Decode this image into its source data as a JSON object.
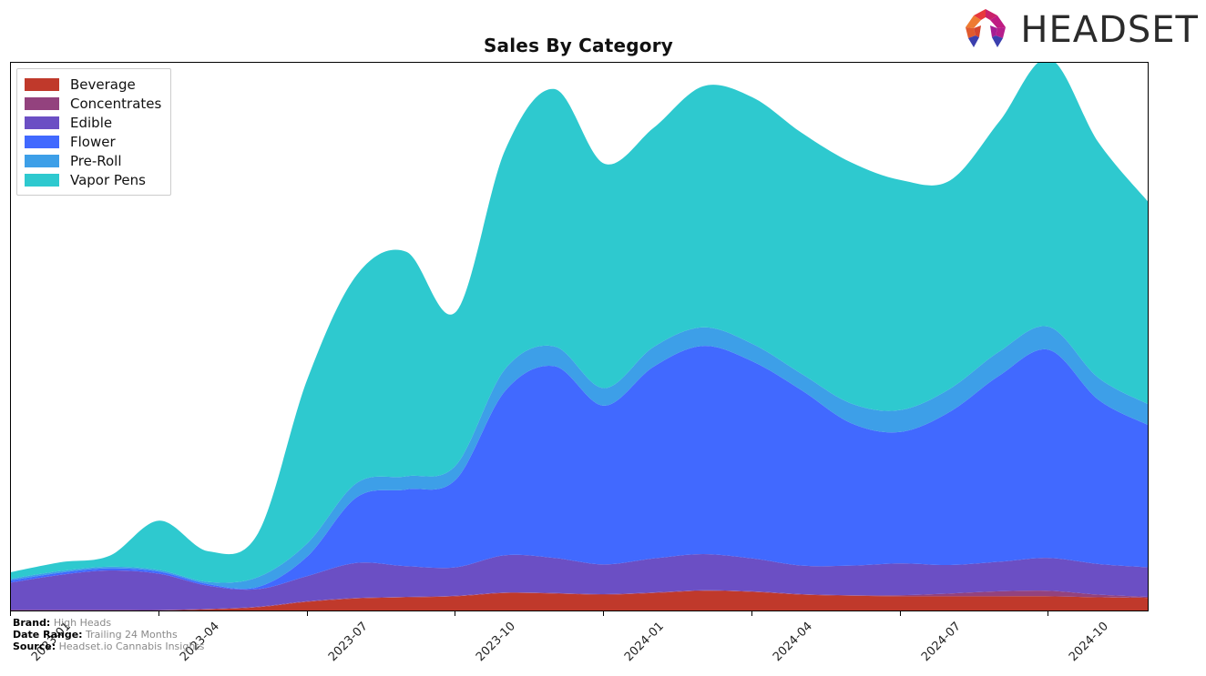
{
  "header": {
    "title": "Sales By Category",
    "logo_word": "HEADSET",
    "logo_icon": "headset-arch-logo"
  },
  "footer": {
    "lines": [
      {
        "key": "Brand:",
        "value": "High Heads"
      },
      {
        "key": "Date Range:",
        "value": "Trailing 24 Months"
      },
      {
        "key": "Source:",
        "value": "Headset.io Cannabis Insights"
      }
    ]
  },
  "legend": {
    "position": "upper-left",
    "items": [
      {
        "label": "Beverage",
        "color": "#c0392b"
      },
      {
        "label": "Concentrates",
        "color": "#93427e"
      },
      {
        "label": "Edible",
        "color": "#6b4fc4"
      },
      {
        "label": "Flower",
        "color": "#4169ff"
      },
      {
        "label": "Pre-Roll",
        "color": "#3d9fe8"
      },
      {
        "label": "Vapor Pens",
        "color": "#2ec9cf"
      }
    ]
  },
  "chart_data": {
    "type": "area",
    "stacked": true,
    "title": "Sales By Category",
    "xlabel": "",
    "ylabel": "",
    "grid": false,
    "legend_position": "upper left",
    "x": [
      "2023-01",
      "2023-02",
      "2023-03",
      "2023-04",
      "2023-05",
      "2023-06",
      "2023-07",
      "2023-08",
      "2023-09",
      "2023-10",
      "2023-11",
      "2023-12",
      "2024-01",
      "2024-02",
      "2024-03",
      "2024-04",
      "2024-05",
      "2024-06",
      "2024-07",
      "2024-08",
      "2024-09",
      "2024-10",
      "2024-11",
      "2024-12"
    ],
    "xticks": [
      "2023-01",
      "2023-04",
      "2023-07",
      "2023-10",
      "2024-01",
      "2024-04",
      "2024-07",
      "2024-10"
    ],
    "ylim": [
      0,
      100
    ],
    "series": [
      {
        "name": "Beverage",
        "color": "#c0392b",
        "values": [
          0.0,
          0.0,
          0.0,
          0.0,
          0.2,
          0.6,
          1.6,
          2.2,
          2.4,
          2.6,
          3.2,
          3.1,
          2.9,
          3.2,
          3.6,
          3.4,
          2.9,
          2.7,
          2.6,
          2.6,
          2.6,
          2.6,
          2.4,
          2.3
        ]
      },
      {
        "name": "Concentrates",
        "color": "#93427e",
        "values": [
          0.1,
          0.1,
          0.1,
          0.1,
          0.1,
          0.1,
          0.1,
          0.1,
          0.1,
          0.1,
          0.1,
          0.1,
          0.1,
          0.1,
          0.1,
          0.1,
          0.1,
          0.1,
          0.2,
          0.5,
          0.9,
          1.0,
          0.5,
          0.2
        ]
      },
      {
        "name": "Edible",
        "color": "#6b4fc4",
        "values": [
          5.0,
          6.4,
          7.2,
          6.6,
          4.2,
          3.2,
          4.6,
          6.4,
          5.6,
          5.2,
          6.8,
          6.4,
          5.4,
          6.2,
          6.6,
          6.0,
          5.2,
          5.4,
          5.8,
          5.2,
          5.4,
          6.0,
          5.6,
          5.4
        ]
      },
      {
        "name": "Flower",
        "color": "#4169ff",
        "values": [
          0.4,
          0.4,
          0.4,
          0.4,
          0.3,
          0.4,
          3.6,
          12.0,
          14.0,
          16.0,
          30.0,
          35.0,
          29.0,
          35.0,
          38.0,
          36.0,
          32.0,
          26.0,
          24.0,
          28.0,
          34.0,
          38.0,
          30.0,
          26.0
        ]
      },
      {
        "name": "Pre-Roll",
        "color": "#3d9fe8",
        "values": [
          0.3,
          0.3,
          0.3,
          0.3,
          0.4,
          1.8,
          2.4,
          2.6,
          2.4,
          2.6,
          4.0,
          3.6,
          3.2,
          3.6,
          3.4,
          3.2,
          3.0,
          3.6,
          4.0,
          4.2,
          4.4,
          4.2,
          4.0,
          3.8
        ]
      },
      {
        "name": "Vapor Pens",
        "color": "#2ec9cf",
        "values": [
          1.2,
          1.6,
          2.0,
          9.0,
          5.6,
          8.0,
          30.0,
          38.0,
          41.0,
          28.0,
          40.0,
          47.0,
          41.0,
          40.0,
          44.0,
          45.0,
          44.0,
          44.0,
          42.0,
          38.0,
          42.0,
          49.0,
          43.0,
          37.0
        ]
      }
    ]
  }
}
